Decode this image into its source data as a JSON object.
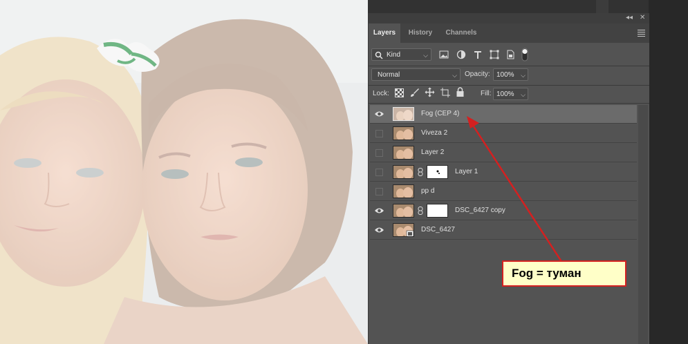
{
  "panel": {
    "tabs": [
      {
        "label": "Layers",
        "active": true
      },
      {
        "label": "History",
        "active": false
      },
      {
        "label": "Channels",
        "active": false
      }
    ],
    "collapse_glyph": "◂◂",
    "close_glyph": "✕",
    "filter": {
      "value": "Kind",
      "icons": [
        "image-filter-icon",
        "type-filter-icon",
        "text-filter-icon",
        "shape-filter-icon",
        "smart-object-filter-icon",
        "filter-toggle-icon"
      ]
    },
    "blend_mode": "Normal",
    "opacity_label": "Opacity:",
    "opacity_value": "100%",
    "lock_label": "Lock:",
    "fill_label": "Fill:",
    "fill_value": "100%",
    "layers": [
      {
        "name": "Fog (CEP 4)",
        "visible": true,
        "selected": true,
        "has_mask": false
      },
      {
        "name": "Viveza 2",
        "visible": false,
        "selected": false,
        "has_mask": false
      },
      {
        "name": "Layer 2",
        "visible": false,
        "selected": false,
        "has_mask": false
      },
      {
        "name": "Layer 1",
        "visible": false,
        "selected": false,
        "has_mask": true
      },
      {
        "name": "pp d",
        "visible": false,
        "selected": false,
        "has_mask": false
      },
      {
        "name": "DSC_6427 copy",
        "visible": true,
        "selected": false,
        "has_mask": true
      },
      {
        "name": "DSC_6427",
        "visible": true,
        "selected": false,
        "has_mask": false
      }
    ]
  },
  "annotation": {
    "text": "Fog = туман",
    "color": "#d42020"
  }
}
